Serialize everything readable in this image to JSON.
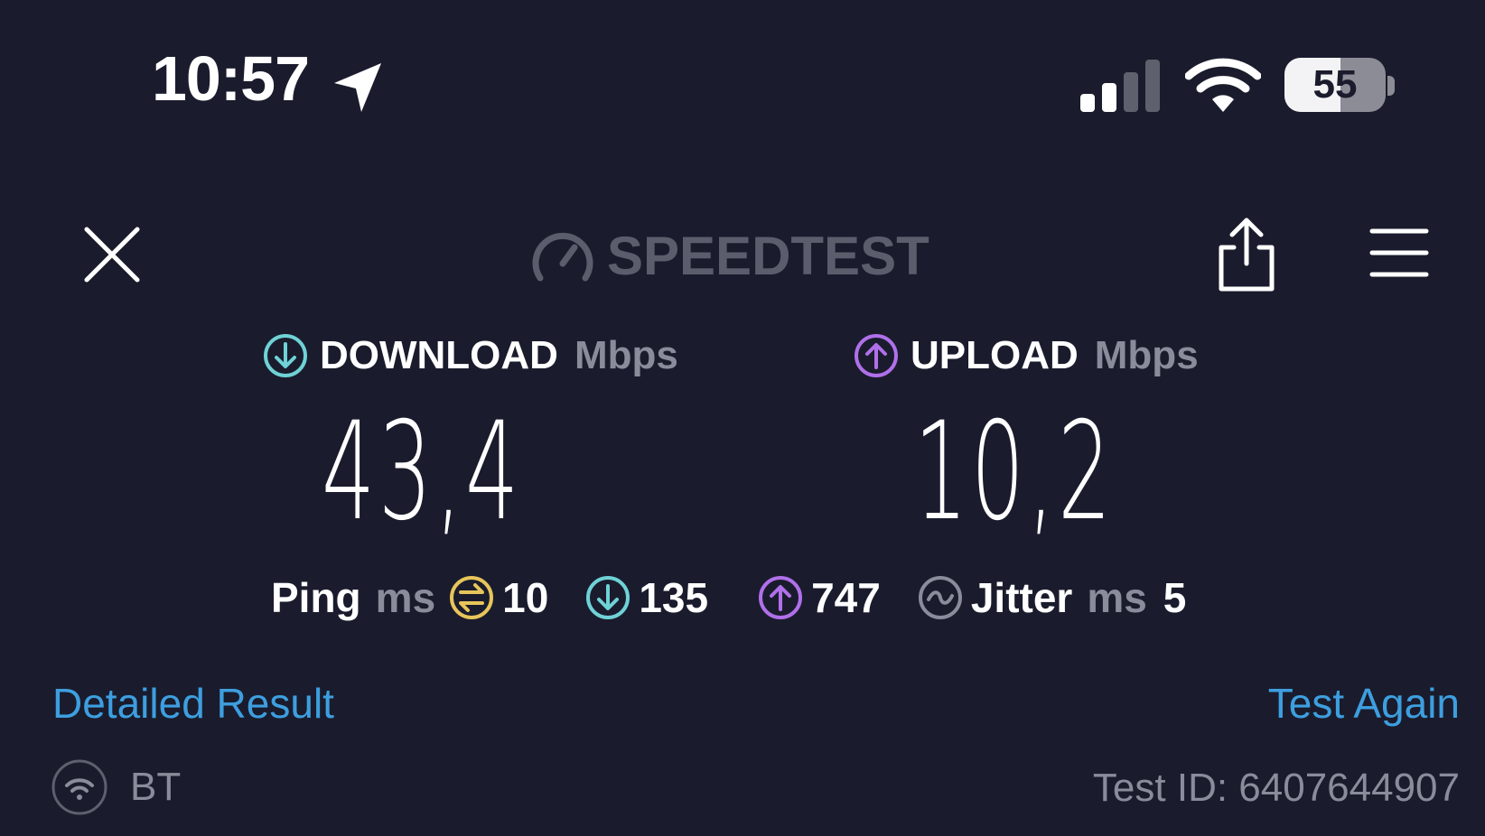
{
  "status_bar": {
    "time": "10:57",
    "battery_level": "55",
    "battery_fraction": 0.55
  },
  "toolbar": {
    "brand": "SPEEDTEST",
    "close_icon": "close-icon",
    "share_icon": "share-icon",
    "menu_icon": "hamburger-menu-icon"
  },
  "download": {
    "label": "DOWNLOAD",
    "unit": "Mbps",
    "value": "43,4",
    "icon": "download-arrow-icon"
  },
  "upload": {
    "label": "UPLOAD",
    "unit": "Mbps",
    "value": "10,2",
    "icon": "upload-arrow-icon"
  },
  "ping": {
    "label": "Ping",
    "unit": "ms",
    "idle": "10",
    "download": "135",
    "upload": "747"
  },
  "jitter": {
    "label": "Jitter",
    "unit": "ms",
    "value": "5"
  },
  "links": {
    "detailed_result": "Detailed Result",
    "test_again": "Test Again"
  },
  "footer": {
    "network_name": "BT",
    "test_id": "Test ID: 6407644907"
  },
  "colors": {
    "background": "#1a1c2d",
    "download_accent": "#6fd2d6",
    "upload_accent": "#b070ea",
    "idle_ping_accent": "#e8c55a",
    "link": "#3d9fe0",
    "muted": "#8a8c9b"
  }
}
